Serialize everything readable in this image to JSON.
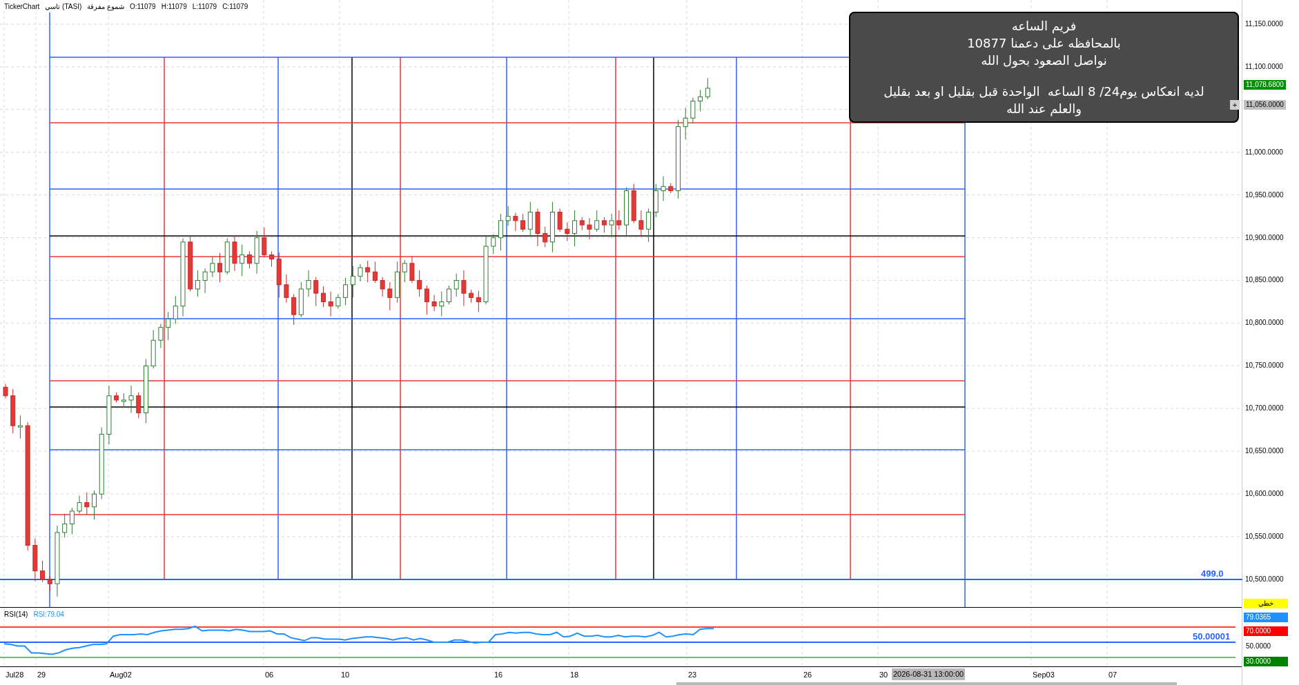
{
  "header": {
    "items": [
      "TickerChart",
      "تاسي (TASI)",
      "شموع مفرقة",
      "O:11079",
      "H:11079",
      "L:11079",
      "C:11079"
    ]
  },
  "note": {
    "paragraphs": [
      [
        "فريم الساعه",
        "بالمحافظه على دعمنا 10877",
        "نواصل الصعود بحول الله"
      ],
      [
        "لديه انعكاس يوم24/ 8 الساعه  الواحدة قبل بقليل او بعد بقليل",
        "والعلم عند الله"
      ]
    ]
  },
  "price_axis": {
    "ticks": [
      "11,150.0000",
      "11,100.0000",
      "11,000.0000",
      "10,950.0000",
      "10,900.0000",
      "10,850.0000",
      "10,800.0000",
      "10,750.0000",
      "10,700.0000",
      "10,650.0000",
      "10,600.0000",
      "10,550.0000",
      "10,500.0000"
    ]
  },
  "price_tags": [
    {
      "text": "11,078.6800",
      "kind": "last"
    },
    {
      "text": "11,056.0000",
      "kind": "cursor"
    }
  ],
  "cursor_button": "+",
  "line_label": "499.0",
  "rsi": {
    "title": "RSI(14)",
    "reading": "RSI:79.04",
    "level_label": "50.00001",
    "tags": [
      {
        "text": "خطي",
        "kind": "style"
      },
      {
        "text": "79.0365",
        "kind": "value"
      },
      {
        "text": "70.0000",
        "kind": "upper"
      },
      {
        "text": "50.0000",
        "kind": "mid"
      },
      {
        "text": "30.0000",
        "kind": "lower"
      }
    ]
  },
  "time_axis": {
    "labels": [
      "Jul28",
      "29",
      "Aug02",
      "06",
      "10",
      "16",
      "18",
      "23",
      "26",
      "30",
      "Sep03",
      "07"
    ],
    "cursor_time": "2026-08-31 13:00:00"
  }
}
